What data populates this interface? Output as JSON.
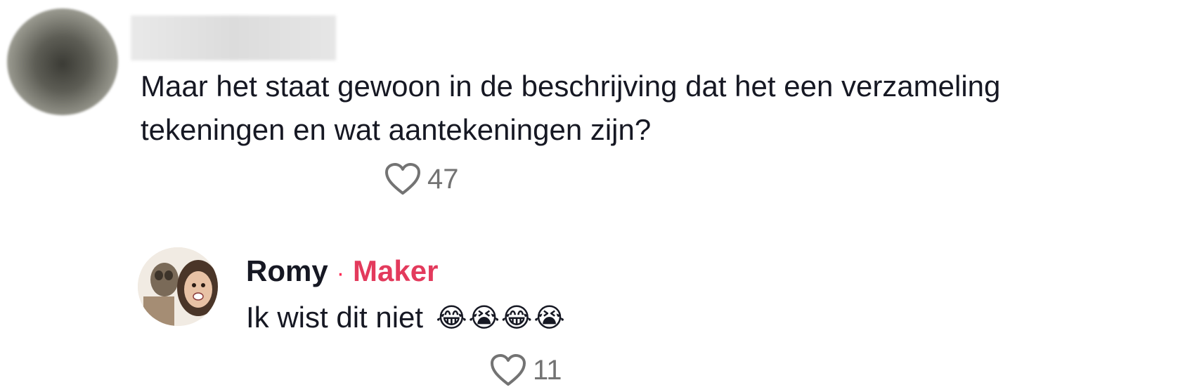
{
  "comment": {
    "text_line1": "Maar het staat gewoon in de beschrijving dat het een verzameling",
    "text_line2": "tekeningen en wat aantekeningen zijn?",
    "like_count": "47",
    "like_icon": "heart-outline-icon"
  },
  "reply": {
    "author": "Romy",
    "separator": "·",
    "badge": "Maker",
    "badge_color": "#e33a5c",
    "text": "Ik wist dit niet",
    "emojis": [
      "😂",
      "😭",
      "😂",
      "😭"
    ],
    "like_count": "11",
    "like_icon": "heart-outline-icon"
  }
}
